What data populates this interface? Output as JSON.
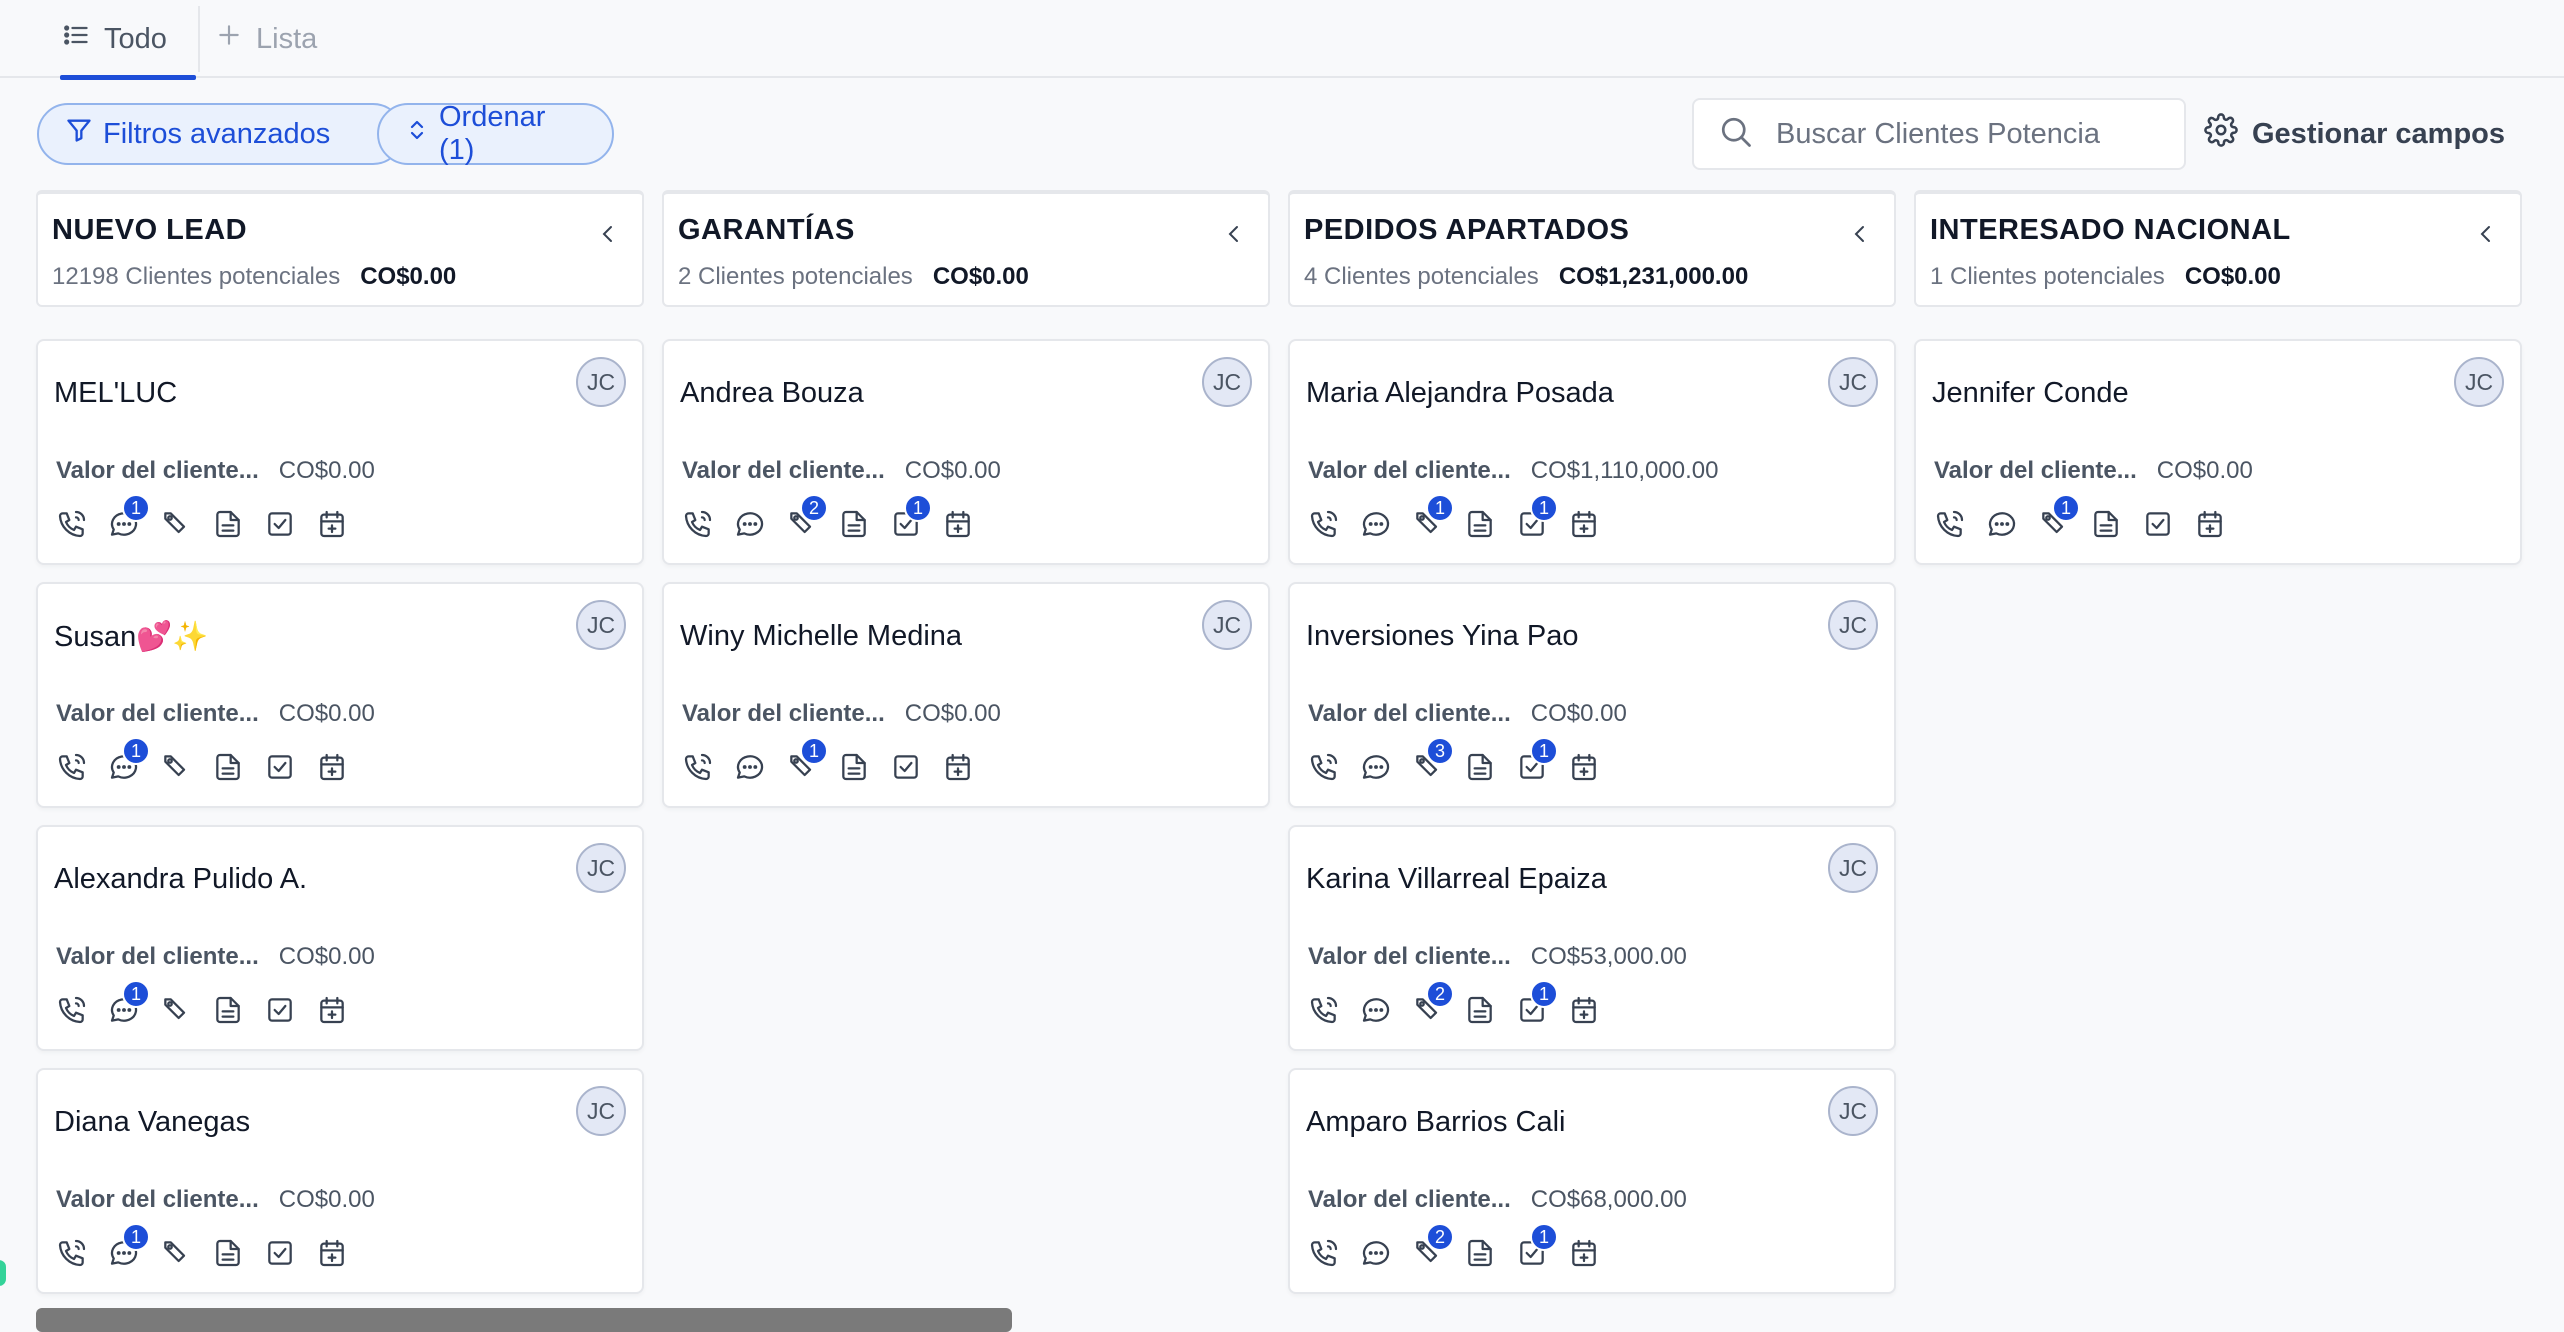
{
  "tabs": {
    "todo": "Todo",
    "lista": "Lista"
  },
  "toolbar": {
    "filters_label": "Filtros avanzados",
    "sort_label": "Ordenar (1)",
    "search_placeholder": "Buscar Clientes Potencia",
    "manage_label": "Gestionar campos"
  },
  "colors": {
    "accent": "#1d4ed8",
    "badge": "#1d4ed8",
    "pill_bg": "#eaf1fd"
  },
  "value_label": "Valor del cliente...",
  "columns": [
    {
      "title": "NUEVO LEAD",
      "count": "12198 Clientes potenciales",
      "total": "CO$0.00",
      "cards": [
        {
          "name": "MEL'LUC",
          "avatar": "JC",
          "value": "CO$0.00",
          "badges": {
            "chat": "1",
            "tag": "",
            "task": ""
          }
        },
        {
          "name": "Susan💕✨",
          "avatar": "JC",
          "value": "CO$0.00",
          "badges": {
            "chat": "1",
            "tag": "",
            "task": ""
          }
        },
        {
          "name": "Alexandra Pulido A.",
          "avatar": "JC",
          "value": "CO$0.00",
          "badges": {
            "chat": "1",
            "tag": "",
            "task": ""
          }
        },
        {
          "name": "Diana Vanegas",
          "avatar": "JC",
          "value": "CO$0.00",
          "badges": {
            "chat": "1",
            "tag": "",
            "task": ""
          }
        }
      ]
    },
    {
      "title": "GARANTÍAS",
      "count": "2 Clientes potenciales",
      "total": "CO$0.00",
      "cards": [
        {
          "name": "Andrea Bouza",
          "avatar": "JC",
          "value": "CO$0.00",
          "badges": {
            "chat": "",
            "tag": "2",
            "task": "1"
          }
        },
        {
          "name": "Winy Michelle Medina",
          "avatar": "JC",
          "value": "CO$0.00",
          "badges": {
            "chat": "",
            "tag": "1",
            "task": ""
          }
        }
      ]
    },
    {
      "title": "PEDIDOS APARTADOS",
      "count": "4 Clientes potenciales",
      "total": "CO$1,231,000.00",
      "cards": [
        {
          "name": "Maria Alejandra Posada",
          "avatar": "JC",
          "value": "CO$1,110,000.00",
          "badges": {
            "chat": "",
            "tag": "1",
            "task": "1"
          }
        },
        {
          "name": "Inversiones Yina Pao",
          "avatar": "JC",
          "value": "CO$0.00",
          "badges": {
            "chat": "",
            "tag": "3",
            "task": "1"
          }
        },
        {
          "name": "Karina Villarreal Epaiza",
          "avatar": "JC",
          "value": "CO$53,000.00",
          "badges": {
            "chat": "",
            "tag": "2",
            "task": "1"
          }
        },
        {
          "name": "Amparo Barrios Cali",
          "avatar": "JC",
          "value": "CO$68,000.00",
          "badges": {
            "chat": "",
            "tag": "2",
            "task": "1"
          }
        }
      ]
    },
    {
      "title": "INTERESADO NACIONAL",
      "count": "1 Clientes potenciales",
      "total": "CO$0.00",
      "cards": [
        {
          "name": "Jennifer Conde",
          "avatar": "JC",
          "value": "CO$0.00",
          "badges": {
            "chat": "",
            "tag": "1",
            "task": ""
          }
        }
      ]
    }
  ]
}
